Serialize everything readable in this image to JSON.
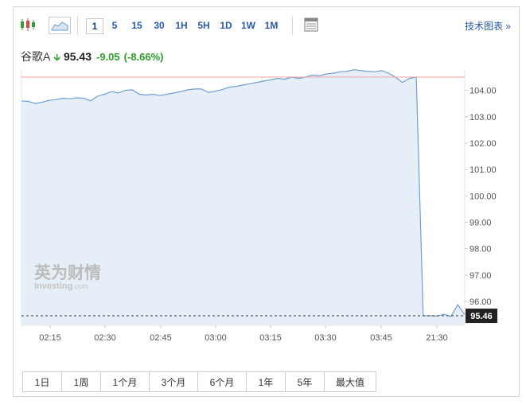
{
  "toolbar": {
    "intervals": [
      "1",
      "5",
      "15",
      "30",
      "1H",
      "5H",
      "1D",
      "1W",
      "1M"
    ],
    "active_interval": "1",
    "tech_chart_link": "技术图表 »"
  },
  "quote": {
    "name": "谷歌A",
    "price": "95.43",
    "change": "-9.05",
    "change_pct": "(-8.66%)"
  },
  "watermark": {
    "cn": "英为财情",
    "en": "Investing",
    "en_suffix": ".com"
  },
  "colors": {
    "line": "#6f9fd0",
    "area": "#e6eef7",
    "down": "#2c9e2c",
    "prev_close_line": "#f2a8a8",
    "accent": "#2a5aa8"
  },
  "periods": [
    "1日",
    "1周",
    "1个月",
    "3个月",
    "6个月",
    "1年",
    "5年",
    "最大值"
  ],
  "chart_data": {
    "type": "area",
    "ylim": [
      95.1,
      104.8
    ],
    "yticks": [
      "104.00",
      "103.00",
      "102.00",
      "101.00",
      "100.00",
      "99.00",
      "98.00",
      "97.00",
      "96.00"
    ],
    "xticks": [
      "02:15",
      "02:30",
      "02:45",
      "03:00",
      "03:15",
      "03:30",
      "03:45",
      "21:30"
    ],
    "reference_line": 104.5,
    "current_price_label": "95.46",
    "series": [
      {
        "values": [
          103.6,
          103.58,
          103.5,
          103.55,
          103.62,
          103.65,
          103.7,
          103.68,
          103.72,
          103.7,
          103.6,
          103.78,
          103.85,
          103.95,
          103.9,
          104.0,
          104.02,
          103.85,
          103.82,
          103.85,
          103.8,
          103.85,
          103.9,
          103.95,
          104.02,
          104.05,
          104.05,
          103.92,
          103.97,
          104.03,
          104.12,
          104.15,
          104.2,
          104.25,
          104.3,
          104.35,
          104.4,
          104.45,
          104.42,
          104.5,
          104.45,
          104.5,
          104.58,
          104.55,
          104.62,
          104.65,
          104.7,
          104.72,
          104.78,
          104.75,
          104.72,
          104.7,
          104.75,
          104.65,
          104.5,
          104.3,
          104.45,
          104.5,
          95.46,
          95.46,
          95.45,
          95.52,
          95.43,
          95.88,
          95.5
        ]
      }
    ]
  }
}
